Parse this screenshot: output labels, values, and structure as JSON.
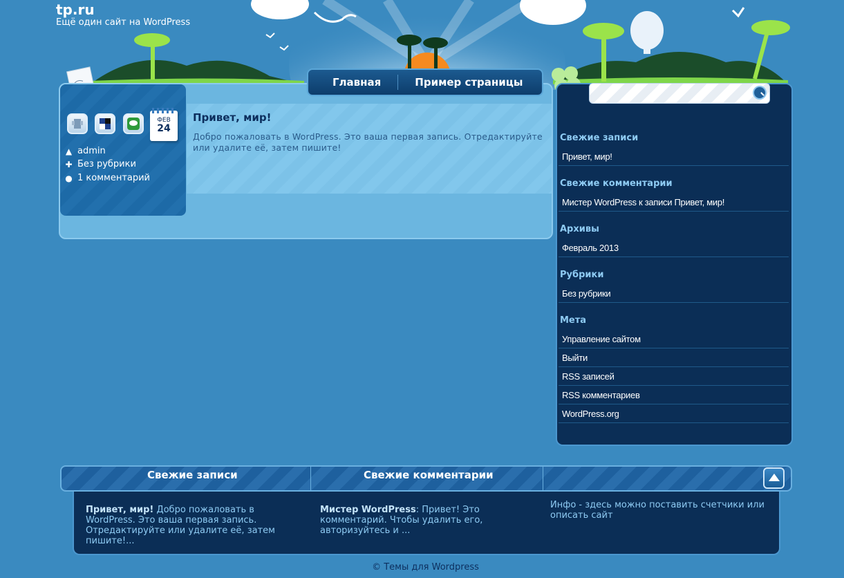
{
  "site": {
    "title": "tp.ru",
    "description": "Ещё один сайт на WordPress"
  },
  "nav": {
    "items": [
      "Главная",
      "Пример страницы"
    ]
  },
  "post": {
    "title": "Привет, мир!",
    "excerpt": "Добро пожаловать в WordPress. Это ваша первая запись. Отредактируйте или удалите её, затем пишите!",
    "date_month": "ФЕВ",
    "date_day": "24",
    "author": "admin",
    "category": "Без рубрики",
    "comments": "1 комментарий"
  },
  "sidebar": {
    "recent_posts": {
      "title": "Свежие записи",
      "items": [
        "Привет, мир!"
      ]
    },
    "recent_comments": {
      "title": "Свежие комментарии",
      "items": [
        "Мистер WordPress к записи Привет, мир!"
      ]
    },
    "archives": {
      "title": "Архивы",
      "items": [
        "Февраль 2013"
      ]
    },
    "categories": {
      "title": "Рубрики",
      "items": [
        "Без рубрики"
      ]
    },
    "meta": {
      "title": "Мета",
      "items": [
        "Управление сайтом",
        "Выйти",
        "RSS записей",
        "RSS комментариев",
        "WordPress.org"
      ]
    }
  },
  "footer": {
    "col1_title": "Свежие записи",
    "col1_strong": "Привет, мир!",
    "col1_text": " Добро пожаловать в WordPress. Это ваша первая запись. Отредактируйте или удалите её, затем пишите!...",
    "col2_title": "Свежие комментарии",
    "col2_strong": "Мистер WordPress",
    "col2_text": ": Привет! Это комментарий. Чтобы удалить его, авторизуйтесь и ...",
    "col3_text": "Инфо - здесь можно поставить счетчики или описать сайт",
    "copyright": "© Темы для Wordpress"
  },
  "colors": {
    "background": "#3a8ac0",
    "sidebar_bg": "#0b2e56",
    "widget_title": "#8ecbf3",
    "post_title": "#0d2f5e"
  }
}
